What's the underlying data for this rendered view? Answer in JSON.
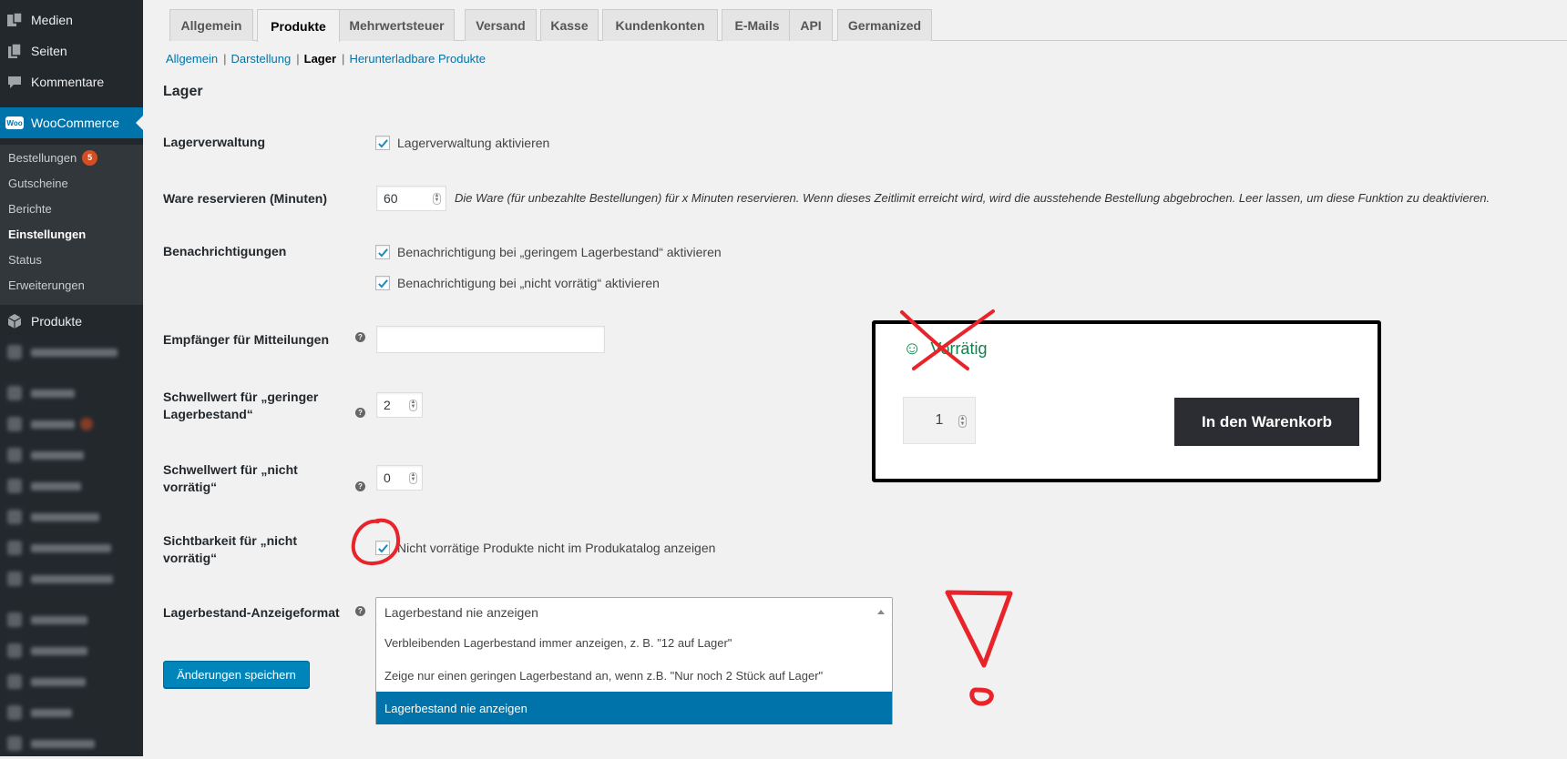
{
  "sidebar": {
    "items": [
      {
        "label": "Medien",
        "icon": "media-icon"
      },
      {
        "label": "Seiten",
        "icon": "pages-icon"
      },
      {
        "label": "Kommentare",
        "icon": "comments-icon"
      },
      {
        "label": "WooCommerce",
        "icon": "woocommerce-icon"
      },
      {
        "label": "Produkte",
        "icon": "products-icon"
      }
    ],
    "woo_badge": "Woo",
    "submenu": [
      {
        "label": "Bestellungen",
        "badge": "5"
      },
      {
        "label": "Gutscheine"
      },
      {
        "label": "Berichte"
      },
      {
        "label": "Einstellungen"
      },
      {
        "label": "Status"
      },
      {
        "label": "Erweiterungen"
      }
    ]
  },
  "tabs": [
    "Allgemein",
    "Produkte",
    "Mehrwertsteuer",
    "Versand",
    "Kasse",
    "Kundenkonten",
    "E-Mails",
    "API",
    "Germanized"
  ],
  "active_tab": "Produkte",
  "subnav": [
    "Allgemein",
    "Darstellung",
    "Lager",
    "Herunterladbare Produkte"
  ],
  "section_title": "Lager",
  "settings": {
    "stock_management": {
      "label": "Lagerverwaltung",
      "checkbox": "Lagerverwaltung aktivieren"
    },
    "hold_stock": {
      "label": "Ware reservieren (Minuten)",
      "value": "60",
      "desc": "Die Ware (für unbezahlte Bestellungen) für x Minuten reservieren. Wenn dieses Zeitlimit erreicht wird, wird die ausstehende Bestellung abgebrochen. Leer lassen, um diese Funktion zu deaktivieren."
    },
    "notifications": {
      "label": "Benachrichtigungen",
      "low": "Benachrichtigung bei „geringem Lagerbestand“ aktivieren",
      "out": "Benachrichtigung bei „nicht vorrätig“ aktivieren"
    },
    "recipient": {
      "label": "Empfänger für Mitteilungen",
      "value": ""
    },
    "low_threshold": {
      "label_1": "Schwellwert für „geringer",
      "label_2": "Lagerbestand“",
      "value": "2"
    },
    "out_threshold": {
      "label_1": "Schwellwert für „nicht",
      "label_2": "vorrätig“",
      "value": "0"
    },
    "visibility": {
      "label_1": "Sichtbarkeit für „nicht",
      "label_2": "vorrätig“",
      "checkbox": "Nicht vorrätige Produkte nicht im Produkatalog anzeigen"
    },
    "stock_format": {
      "label": "Lagerbestand-Anzeigeformat",
      "selected": "Lagerbestand nie anzeigen",
      "options": [
        "Verbleibenden Lagerbestand immer anzeigen, z. B. \"12 auf Lager\"",
        "Zeige nur einen geringen Lagerbestand an, wenn z.B. \"Nur noch 2 Stück auf Lager\"",
        "Lagerbestand nie anzeigen"
      ]
    },
    "help_glyph": "?"
  },
  "save_button": "Änderungen speichern",
  "preview": {
    "stock_status": "Vorrätig",
    "quantity": "1",
    "add_to_cart": "In den Warenkorb"
  },
  "colors": {
    "sidebar_bg": "#23282d",
    "accent": "#0073aa",
    "in_stock_green": "#0f834d",
    "annotation_red": "#e8232a"
  }
}
